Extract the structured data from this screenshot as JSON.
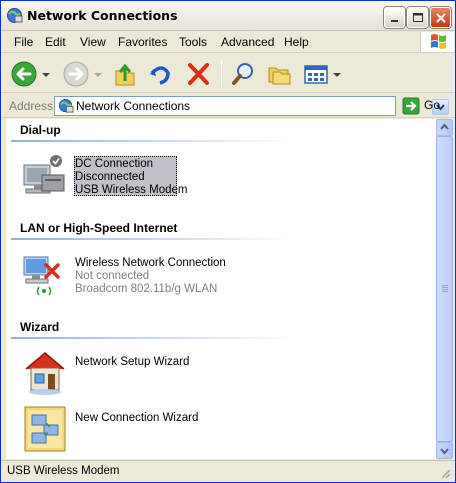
{
  "window": {
    "title": "Network Connections"
  },
  "menu": [
    "File",
    "Edit",
    "View",
    "Favorites",
    "Tools",
    "Advanced",
    "Help"
  ],
  "address": {
    "label": "Address",
    "value": "Network Connections",
    "go_label": "Go"
  },
  "groups": [
    {
      "title": "Dial-up",
      "items": [
        {
          "name": "DC Connection",
          "status": "Disconnected",
          "device": "USB Wireless Modem",
          "icon": "dialup-modem-icon",
          "selected": true
        }
      ]
    },
    {
      "title": "LAN or High-Speed Internet",
      "items": [
        {
          "name": "Wireless Network Connection",
          "status": "Not connected",
          "device": "Broadcom 802.11b/g WLAN",
          "icon": "wireless-network-icon",
          "selected": false
        }
      ]
    },
    {
      "title": "Wizard",
      "items": [
        {
          "name": "Network Setup Wizard",
          "icon": "network-setup-wizard-icon"
        },
        {
          "name": "New Connection Wizard",
          "icon": "new-connection-wizard-icon"
        }
      ]
    }
  ],
  "status_bar": {
    "text": "USB Wireless Modem"
  },
  "colors": {
    "accent": "#0831d9",
    "selection": "#c0c0c8",
    "group_line": "#92aee0"
  }
}
